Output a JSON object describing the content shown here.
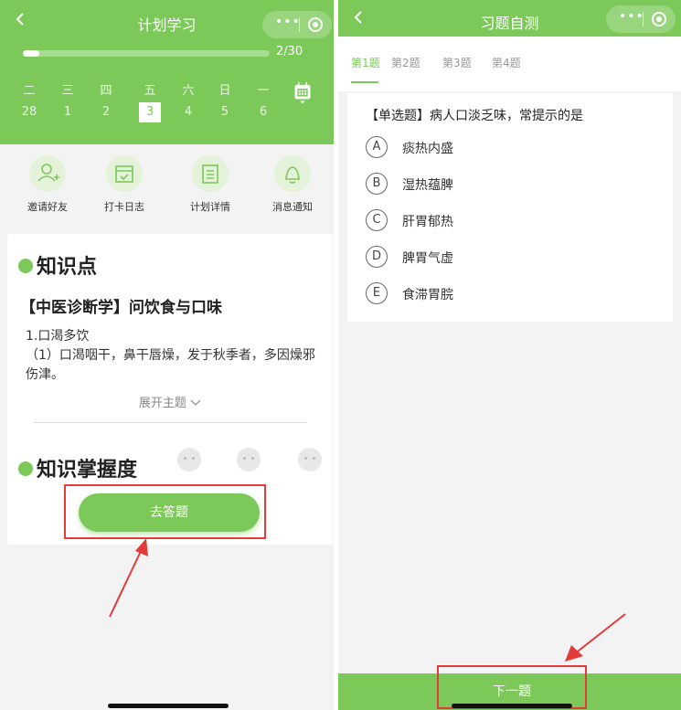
{
  "left": {
    "nav_title": "计划学习",
    "progress_text": "2/30",
    "progress_fraction": 0.0667,
    "weekdays": [
      "二",
      "三",
      "四",
      "五",
      "六",
      "日",
      "一"
    ],
    "dates": [
      "28",
      "1",
      "2",
      "3",
      "4",
      "5",
      "6"
    ],
    "active_date_index": 3,
    "features": [
      {
        "label": "邀请好友",
        "icon": "add-user-icon"
      },
      {
        "label": "打卡日志",
        "icon": "calendar-check-icon"
      },
      {
        "label": "计划详情",
        "icon": "document-icon"
      },
      {
        "label": "消息通知",
        "icon": "bell-icon"
      }
    ],
    "knowledge_title": "知识点",
    "topic_title": "【中医诊断学】问饮食与口味",
    "body_line1": "1.口渴多饮",
    "body_line2": "（1）口渴咽干，鼻干唇燥，发于秋季者，多因燥邪伤津。",
    "expand_label": "展开主题",
    "mastery_title": "知识掌握度",
    "go_button": "去答题"
  },
  "right": {
    "nav_title": "习题自测",
    "tabs": [
      "第1题",
      "第2题",
      "第3题",
      "第4题"
    ],
    "active_tab": 0,
    "question": "【单选题】病人口淡乏味，常提示的是",
    "options": [
      {
        "letter": "A",
        "text": "痰热内盛"
      },
      {
        "letter": "B",
        "text": "湿热蕴脾"
      },
      {
        "letter": "C",
        "text": "肝胃郁热"
      },
      {
        "letter": "D",
        "text": "脾胃气虚"
      },
      {
        "letter": "E",
        "text": "食滞胃脘"
      }
    ],
    "next_button": "下一题"
  },
  "colors": {
    "brand_green": "#7cc95a",
    "light_green": "#e3f2d8",
    "annotation_red": "#e23b3b"
  }
}
